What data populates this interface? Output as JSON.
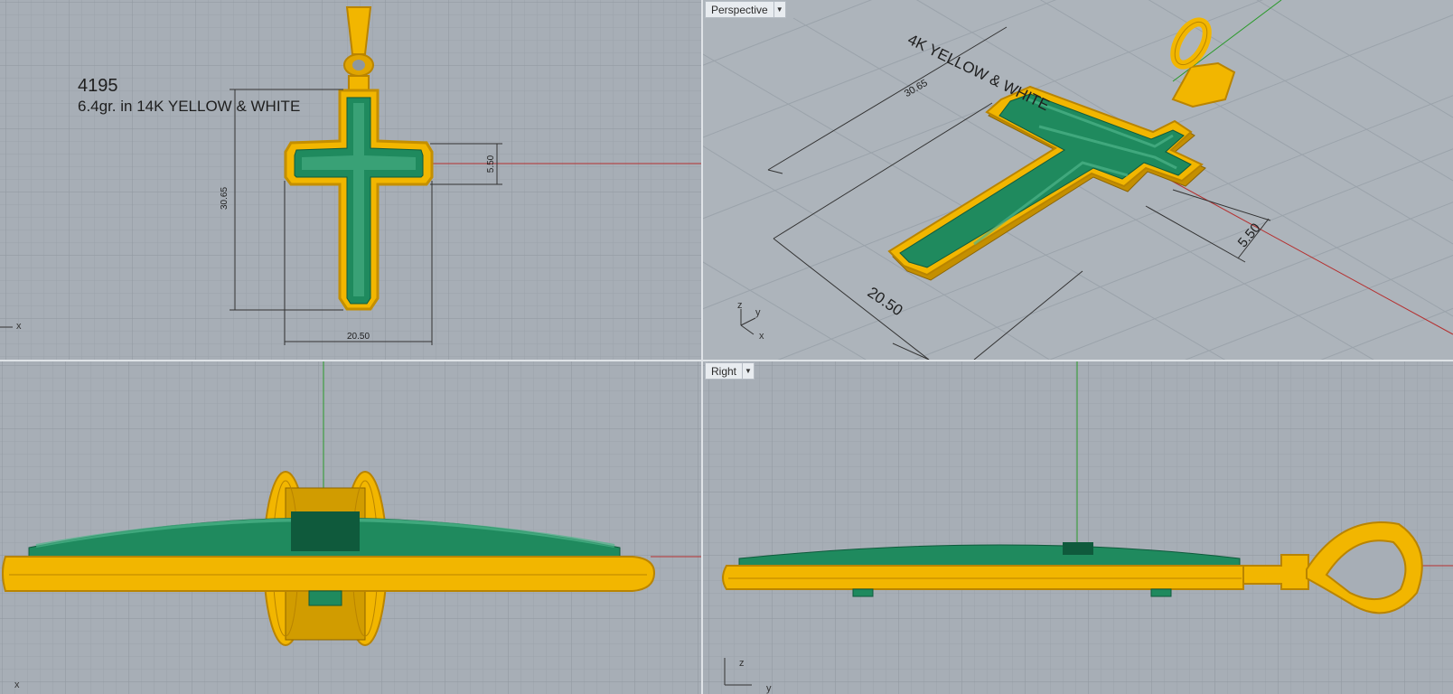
{
  "app": "Rhino 3D modeling viewports",
  "viewports": {
    "top": {
      "name": ""
    },
    "perspective": {
      "name": "Perspective",
      "dropdown_icon": "chevron-down-icon"
    },
    "front": {
      "name": ""
    },
    "right": {
      "name": "Right",
      "dropdown_icon": "chevron-down-icon"
    }
  },
  "annotation": {
    "model_number": "4195",
    "description": "6.4gr. in 14K YELLOW & WHITE",
    "perspective_text": "4K YELLOW & WHITE"
  },
  "dimensions": {
    "height": "30.65",
    "width": "20.50",
    "arm": "5.50"
  },
  "axes": {
    "x": "x",
    "y": "y",
    "z": "z"
  },
  "colors": {
    "gold": "#f2b600",
    "gold_dark": "#b98400",
    "enamel": "#1f8a5e",
    "enamel_light": "#4fb58a",
    "grid_bg": "#a7aeb6",
    "x_axis": "#b53030",
    "y_axis": "#2a9a2a"
  }
}
